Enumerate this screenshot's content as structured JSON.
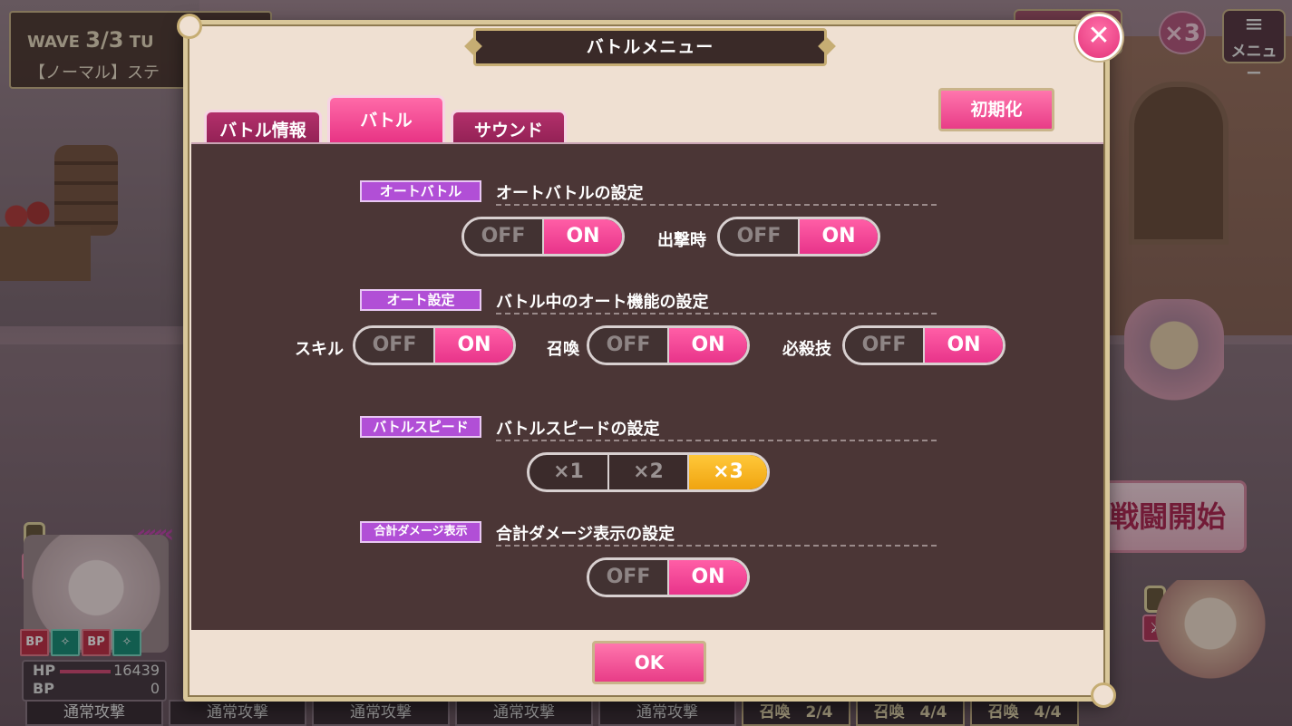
{
  "hud": {
    "wave_prefix": "WAVE",
    "wave_value": "3/3",
    "wave_suffix": "TU",
    "stage": "【ノーマル】ステ",
    "speed_badge": "×3",
    "menu_icon": "≡",
    "menu_label": "メニュー",
    "battle_start": "戦闘開始",
    "chevrons": "«««"
  },
  "party": {
    "bp_chips": [
      "BP",
      "✧",
      "BP",
      "✧"
    ],
    "hp_label": "HP",
    "hp_value": "16439",
    "bp_label": "BP",
    "bp_value": "0"
  },
  "bottom_bar": {
    "items": [
      "通常攻撃",
      "通常攻撃",
      "通常攻撃",
      "通常攻撃",
      "通常攻撃"
    ],
    "summons": [
      "召喚　2/4",
      "召喚　4/4",
      "召喚　4/4"
    ]
  },
  "modal": {
    "title": "バトルメニュー",
    "close_icon": "✕",
    "reset_label": "初期化",
    "tabs": [
      {
        "label": "バトル情報",
        "state": "inactive"
      },
      {
        "label": "バトル",
        "state": "active"
      },
      {
        "label": "サウンド",
        "state": "inactive"
      }
    ],
    "sections": {
      "auto_battle": {
        "badge": "オートバトル",
        "title": "オートバトルの設定",
        "toggle1": {
          "off": "OFF",
          "on": "ON",
          "value": "ON"
        },
        "sortie_label": "出撃時",
        "toggle2": {
          "off": "OFF",
          "on": "ON",
          "value": "ON"
        }
      },
      "auto_settings": {
        "badge": "オート設定",
        "title": "バトル中のオート機能の設定",
        "skill_label": "スキル",
        "skill": {
          "off": "OFF",
          "on": "ON",
          "value": "ON"
        },
        "summon_label": "召喚",
        "summon": {
          "off": "OFF",
          "on": "ON",
          "value": "ON"
        },
        "special_label": "必殺技",
        "special": {
          "off": "OFF",
          "on": "ON",
          "value": "ON"
        }
      },
      "battle_speed": {
        "badge": "バトルスピード",
        "title": "バトルスピードの設定",
        "options": [
          "×1",
          "×2",
          "×3"
        ],
        "selected": "×3"
      },
      "damage_display": {
        "badge": "合計ダメージ表示",
        "title": "合計ダメージ表示の設定",
        "toggle": {
          "off": "OFF",
          "on": "ON",
          "value": "ON"
        }
      }
    },
    "ok_label": "OK"
  }
}
